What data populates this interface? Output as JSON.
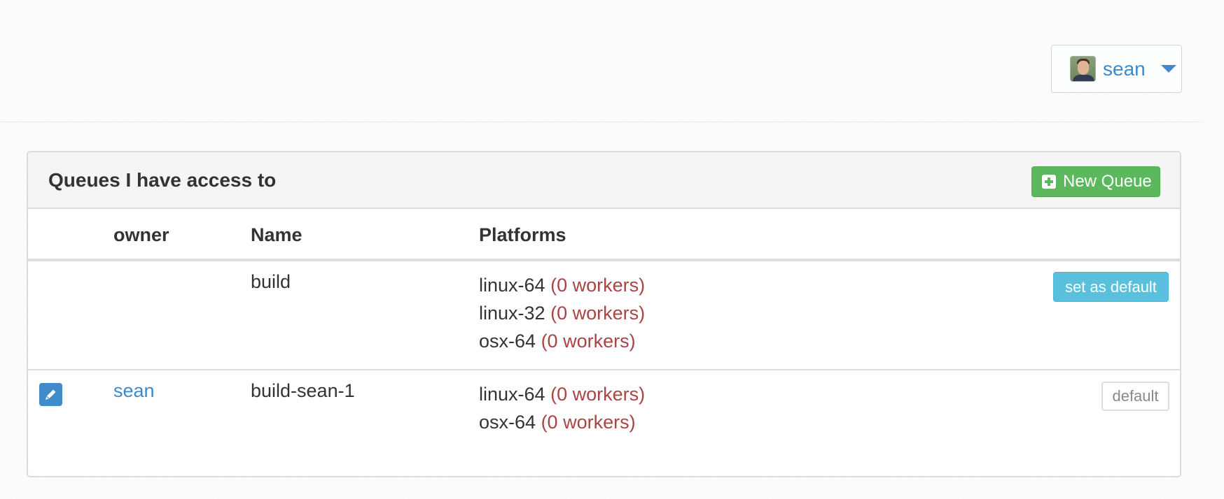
{
  "user_menu": {
    "username": "sean",
    "avatar": "user-avatar",
    "caret_icon": "chevron-down-icon"
  },
  "panel": {
    "title": "Queues I have access to",
    "new_queue_label": "New Queue",
    "new_queue_icon": "plus-square-icon"
  },
  "table": {
    "headers": {
      "owner": "owner",
      "name": "Name",
      "platforms": "Platforms"
    },
    "rows": [
      {
        "owner": "",
        "name": "build",
        "platforms": [
          {
            "platform": "linux-64",
            "workers": "(0 workers)"
          },
          {
            "platform": "linux-32",
            "workers": "(0 workers)"
          },
          {
            "platform": "osx-64",
            "workers": "(0 workers)"
          }
        ],
        "action_label": "set as default"
      },
      {
        "owner": "sean",
        "edit_icon": "pencil-icon",
        "name": "build-sean-1",
        "platforms": [
          {
            "platform": "linux-64",
            "workers": "(0 workers)"
          },
          {
            "platform": "osx-64",
            "workers": "(0 workers)"
          }
        ],
        "status_label": "default"
      }
    ]
  },
  "colors": {
    "link": "#3d8ad0",
    "workers": "#a94442",
    "success": "#5cb85c",
    "info": "#5bc0de",
    "edit": "#428bca"
  }
}
